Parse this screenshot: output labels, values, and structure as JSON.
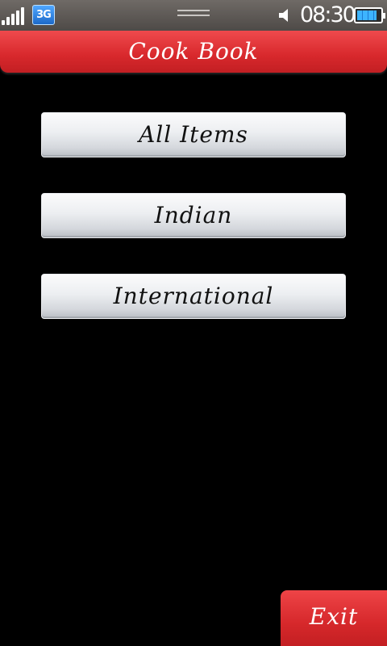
{
  "status_bar": {
    "network_type": "3G",
    "time": "08:30",
    "signal_bars": 5,
    "battery_level": 0.85,
    "icons": [
      "signal-strength-icon",
      "network-3g-icon",
      "drag-handle-icon",
      "speaker-icon",
      "battery-icon"
    ]
  },
  "header": {
    "title": "Cook Book"
  },
  "menu": {
    "items": [
      {
        "label": "All Items"
      },
      {
        "label": "Indian"
      },
      {
        "label": "International"
      }
    ]
  },
  "softkeys": {
    "exit_label": "Exit"
  },
  "colors": {
    "accent": "#d8282c",
    "background": "#000000",
    "button_text": "#111111"
  }
}
